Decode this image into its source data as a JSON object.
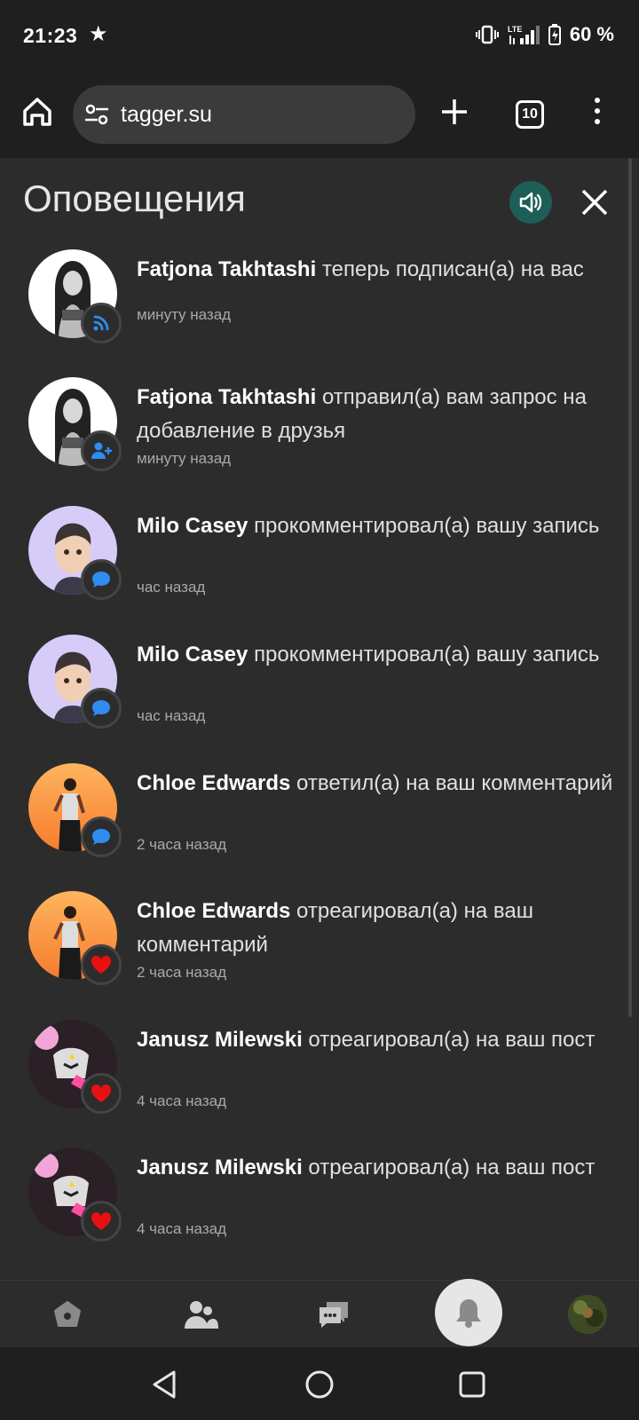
{
  "status": {
    "time": "21:23",
    "battery": "60 %",
    "network": "LTE"
  },
  "browser": {
    "url": "tagger.su",
    "tab_count": "10"
  },
  "panel": {
    "title": "Оповещения"
  },
  "notifications": [
    {
      "name": "Fatjona Takhtashi",
      "action": "теперь подписан(а) на вас",
      "time": "минуту назад",
      "badge": "rss-icon",
      "avatar": "bw"
    },
    {
      "name": "Fatjona Takhtashi",
      "action": "отправил(а) вам запрос на добавление в друзья",
      "time": "минуту назад",
      "badge": "add-friend-icon",
      "avatar": "bw"
    },
    {
      "name": "Milo Casey",
      "action": "прокомментировал(а) вашу запись",
      "time": "час назад",
      "badge": "comment-icon",
      "avatar": "lilac"
    },
    {
      "name": "Milo Casey",
      "action": "прокомментировал(а) вашу запись",
      "time": "час назад",
      "badge": "comment-icon",
      "avatar": "lilac"
    },
    {
      "name": "Chloe Edwards",
      "action": "ответил(а) на ваш комментарий",
      "time": "2 часа назад",
      "badge": "comment-icon",
      "avatar": "orange"
    },
    {
      "name": "Chloe Edwards",
      "action": "отреагировал(а) на ваш комментарий",
      "time": "2 часа назад",
      "badge": "heart-icon",
      "avatar": "orange"
    },
    {
      "name": "Janusz Milewski",
      "action": "отреагировал(а) на ваш пост",
      "time": "4 часа назад",
      "badge": "heart-icon",
      "avatar": "pink"
    },
    {
      "name": "Janusz Milewski",
      "action": "отреагировал(а) на ваш пост",
      "time": "4 часа назад",
      "badge": "heart-icon",
      "avatar": "pink"
    }
  ],
  "colors": {
    "accent_blue": "#2f8cf0",
    "heart_red": "#e81010",
    "sound_button": "#1d5f57"
  }
}
